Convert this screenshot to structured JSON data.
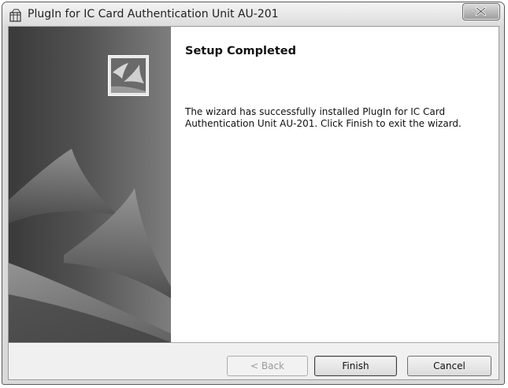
{
  "window": {
    "title": "PlugIn for IC Card Authentication Unit AU-201",
    "app_icon": "installer-package-icon",
    "close_icon": "close-icon"
  },
  "content": {
    "heading": "Setup Completed",
    "message": "The wizard has successfully installed PlugIn for IC Card Authentication Unit AU-201. Click Finish to exit the wizard."
  },
  "buttons": {
    "back": "< Back",
    "finish": "Finish",
    "cancel": "Cancel"
  },
  "banner": {
    "logo_icon": "setup-logo-icon"
  }
}
